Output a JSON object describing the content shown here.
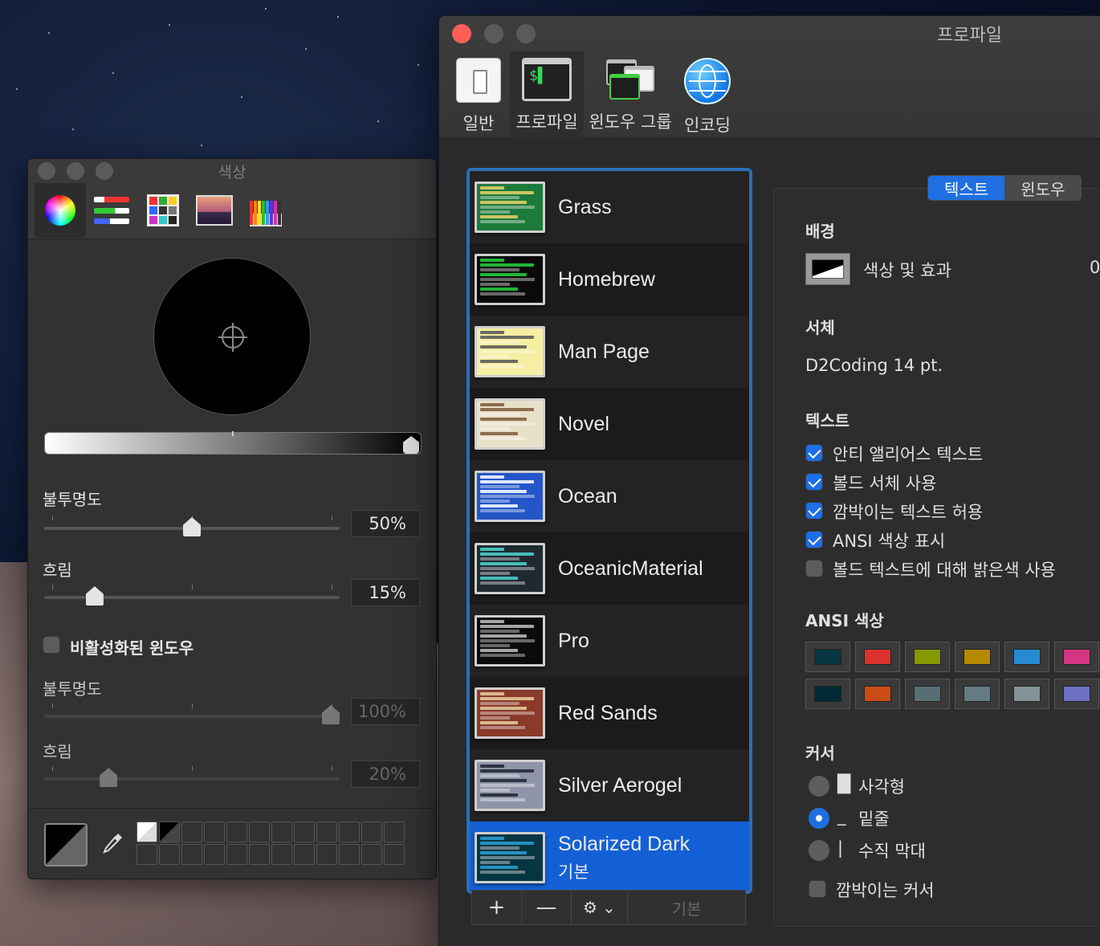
{
  "color_panel": {
    "title": "색상",
    "tabs": [
      "color-wheel-icon",
      "color-sliders-icon",
      "color-palettes-icon",
      "image-palettes-icon",
      "pencils-icon"
    ],
    "opacity_label": "불투명도",
    "opacity_value": "50%",
    "blur_label": "흐림",
    "blur_value": "15%",
    "inactive_window_label": "비활성화된 윈도우",
    "inactive_opacity_label": "불투명도",
    "inactive_opacity_value": "100%",
    "inactive_blur_label": "흐림",
    "inactive_blur_value": "20%",
    "opacity_level": 0.5,
    "blur_level": 0.15,
    "inactive_opacity_level": 1.0,
    "inactive_blur_level": 0.2
  },
  "prefs": {
    "title": "프로파일",
    "tabs": [
      {
        "label": "일반",
        "icon": "general-icon"
      },
      {
        "label": "프로파일",
        "icon": "profile-terminal-icon"
      },
      {
        "label": "윈도우 그룹",
        "icon": "window-group-icon"
      },
      {
        "label": "인코딩",
        "icon": "globe-icon"
      }
    ],
    "profiles": [
      {
        "name": "Grass",
        "bg": "#1c7a3a",
        "accent": "#e9d36a"
      },
      {
        "name": "Homebrew",
        "bg": "#0a0a0a",
        "accent": "#23d33c"
      },
      {
        "name": "Man Page",
        "bg": "#f6eea2",
        "accent": "#555555"
      },
      {
        "name": "Novel",
        "bg": "#e9e0c8",
        "accent": "#7a5a3a"
      },
      {
        "name": "Ocean",
        "bg": "#2456c8",
        "accent": "#ffffff"
      },
      {
        "name": "OceanicMaterial",
        "bg": "#1f2a30",
        "accent": "#4cd6d0"
      },
      {
        "name": "Pro",
        "bg": "#0b0b0b",
        "accent": "#bfbfbf"
      },
      {
        "name": "Red Sands",
        "bg": "#8a3a2a",
        "accent": "#e8cfa0"
      },
      {
        "name": "Silver Aerogel",
        "bg": "#8f95a8",
        "accent": "#1e2233"
      },
      {
        "name": "Solarized Dark",
        "sub": "기본",
        "bg": "#073642",
        "accent": "#2aa1d6"
      }
    ],
    "profile_bar": {
      "plus": "+",
      "minus": "—",
      "default": "기본"
    },
    "segments": [
      "텍스트",
      "윈도우"
    ],
    "background_label": "배경",
    "background_action": "색상 및 효과",
    "background_extra": "0",
    "font_label": "서체",
    "font_value": "D2Coding 14 pt.",
    "text_label": "텍스트",
    "text_options": [
      {
        "label": "안티 앨리어스 텍스트",
        "checked": true
      },
      {
        "label": "볼드 서체 사용",
        "checked": true
      },
      {
        "label": "깜박이는 텍스트 허용",
        "checked": true
      },
      {
        "label": "ANSI 색상 표시",
        "checked": true
      },
      {
        "label": "볼드 텍스트에 대해 밝은색 사용",
        "checked": false
      }
    ],
    "ansi_label": "ANSI 색상",
    "ansi_colors": [
      "#073642",
      "#dc322f",
      "#859900",
      "#b58900",
      "#268bd2",
      "#d33682",
      "#002b36",
      "#cb4b16",
      "#586e75",
      "#657b83",
      "#839496",
      "#6c71c4"
    ],
    "cursor_label": "커서",
    "cursor_options": [
      {
        "glyph": "█",
        "label": "사각형",
        "selected": false
      },
      {
        "glyph": "_",
        "label": "밑줄",
        "selected": true
      },
      {
        "glyph": "|",
        "label": "수직 막대",
        "selected": false
      }
    ],
    "blink_cursor": "깜박이는 커서"
  }
}
